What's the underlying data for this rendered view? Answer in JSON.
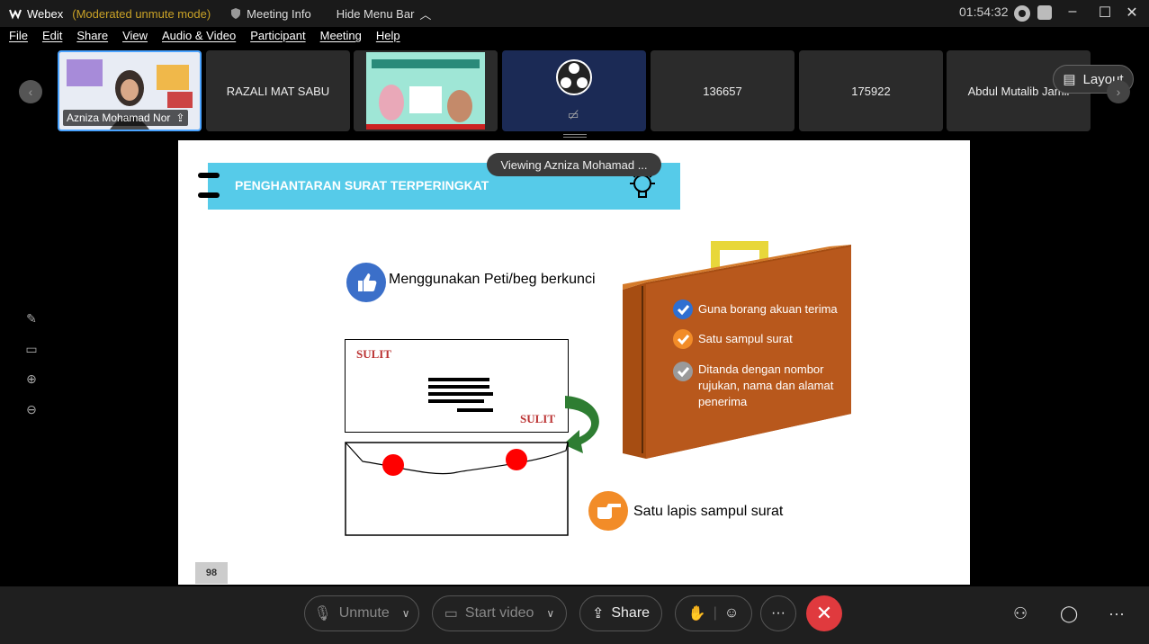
{
  "titlebar": {
    "app_name": "Webex",
    "mode": "(Moderated unmute mode)",
    "meeting_info": "Meeting Info",
    "hide_menu_bar": "Hide Menu Bar",
    "clock": "01:54:32"
  },
  "menu": [
    "File",
    "Edit",
    "Share",
    "View",
    "Audio & Video",
    "Participant",
    "Meeting",
    "Help"
  ],
  "thumbnails": {
    "active_name": "Azniza Mohamad Nor",
    "items": [
      "RAZALI MAT SABU",
      "136657",
      "175922",
      "Abdul Mutalib Jamil"
    ],
    "layout_label": "Layout"
  },
  "viewing": "Viewing Azniza Mohamad ...",
  "slide": {
    "title": "PENGHANTARAN SURAT TERPERINGKAT",
    "label_peti": "Menggunakan Peti/beg berkunci",
    "label_lapis": "Satu lapis sampul surat",
    "sulit": "SULIT",
    "case_items": [
      "Guna borang akuan terima",
      "Satu sampul surat",
      "Ditanda dengan nombor rujukan, nama dan alamat penerima"
    ],
    "page_number": "98"
  },
  "controls": {
    "unmute": "Unmute",
    "start_video": "Start video",
    "share": "Share"
  },
  "colors": {
    "banner": "#56cbe9",
    "briefcase": "#b8581c",
    "end_call": "#e03a3e",
    "active_border": "#4aa3ff"
  }
}
